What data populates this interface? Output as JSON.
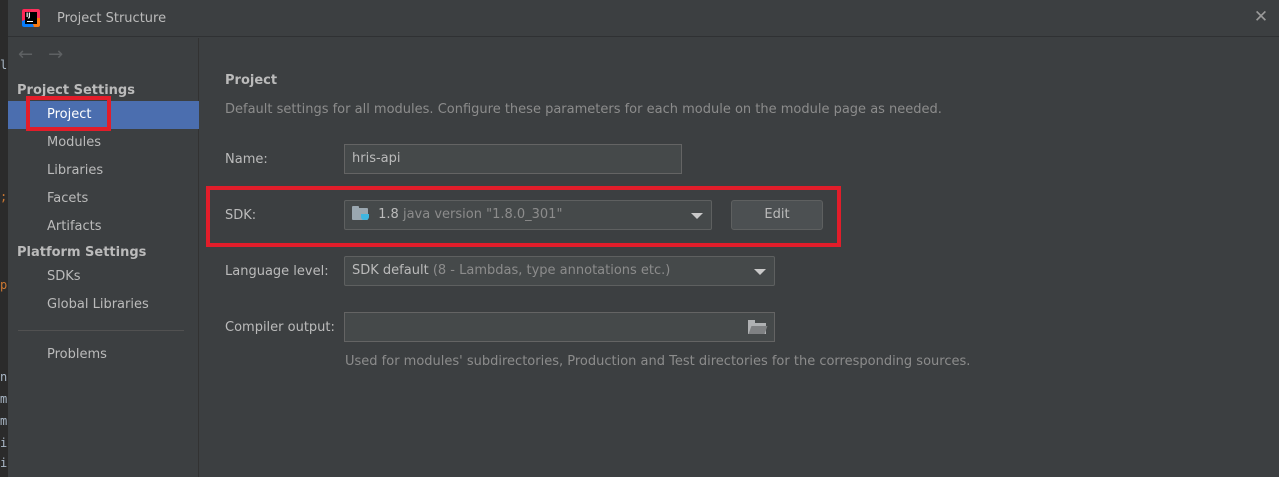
{
  "window": {
    "title": "Project Structure",
    "close_glyph": "✕"
  },
  "editor_bleed": {
    "chars": [
      "l",
      ";",
      "p",
      "n",
      "m",
      "m",
      "i",
      "i"
    ]
  },
  "nav": {
    "back_glyph": "←",
    "forward_glyph": "→"
  },
  "sidebar": {
    "project_settings_label": "Project Settings",
    "project_settings_items": [
      {
        "label": "Project",
        "selected": true
      },
      {
        "label": "Modules"
      },
      {
        "label": "Libraries"
      },
      {
        "label": "Facets"
      },
      {
        "label": "Artifacts"
      }
    ],
    "platform_settings_label": "Platform Settings",
    "platform_settings_items": [
      {
        "label": "SDKs"
      },
      {
        "label": "Global Libraries"
      }
    ],
    "problems_label": "Problems"
  },
  "main": {
    "title": "Project",
    "description": "Default settings for all modules. Configure these parameters for each module on the module page as needed.",
    "name_label": "Name:",
    "name_value": "hris-api",
    "sdk_label": "SDK:",
    "sdk_version": "1.8",
    "sdk_detail": "java version \"1.8.0_301\"",
    "edit_label": "Edit",
    "language_level_label": "Language level:",
    "language_level_value": "SDK default",
    "language_level_detail": "(8 - Lambdas, type annotations etc.)",
    "compiler_output_label": "Compiler output:",
    "compiler_output_value": "",
    "compiler_output_hint": "Used for modules' subdirectories, Production and Test directories for the corresponding sources."
  },
  "colors": {
    "selection": "#4b6eaf",
    "highlight_annotation": "#e21d2a",
    "background": "#3c3f41"
  }
}
